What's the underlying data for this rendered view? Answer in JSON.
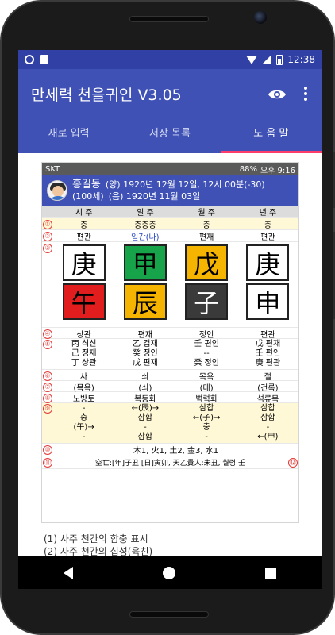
{
  "status_bar": {
    "time": "12:38"
  },
  "app_bar": {
    "title": "만세력 천을귀인 V3.05",
    "actions": [
      "eye-icon",
      "menu-icon"
    ]
  },
  "tabs": [
    {
      "label": "새로 입력"
    },
    {
      "label": "저장 목록"
    },
    {
      "label": "도 움 말",
      "active": true
    }
  ],
  "embedded": {
    "status_left": "SKT",
    "status_right": "88%",
    "status_time": "오후 9:16",
    "header": {
      "name": "홍길동",
      "age": "(100세)",
      "solar": "(양) 1920년 12월 12일, 12시 00분(-30)",
      "lunar": "(음) 1920년 11월 03일"
    },
    "columns": [
      "시 주",
      "일 주",
      "월 주",
      "년 주"
    ],
    "row1": {
      "n": "①",
      "cells": [
        "충",
        "충충충",
        "충",
        "충"
      ]
    },
    "row2": {
      "n": "②",
      "cells": [
        "편관",
        "일간(나)",
        "편재",
        "편관"
      ]
    },
    "row3": {
      "n": "③"
    },
    "stems": [
      {
        "ch": "庚",
        "bg": "#ffffff",
        "fg": "#000000"
      },
      {
        "ch": "甲",
        "bg": "#17a34a",
        "fg": "#000000"
      },
      {
        "ch": "戊",
        "bg": "#f5b400",
        "fg": "#000000"
      },
      {
        "ch": "庚",
        "bg": "#ffffff",
        "fg": "#000000"
      }
    ],
    "branches": [
      {
        "ch": "午",
        "bg": "#e11d1d",
        "fg": "#000000"
      },
      {
        "ch": "辰",
        "bg": "#f5b400",
        "fg": "#000000"
      },
      {
        "ch": "子",
        "bg": "#3a3a3a",
        "fg": "#ffffff"
      },
      {
        "ch": "申",
        "bg": "#ffffff",
        "fg": "#000000"
      }
    ],
    "row4": {
      "n": "④",
      "cells": [
        "상관",
        "편재",
        "정인",
        "편관"
      ]
    },
    "row5": {
      "n": "⑤",
      "lines": [
        [
          "丙 식신",
          "乙 겁재",
          "壬 편인",
          "戊 편재"
        ],
        [
          "己 정재",
          "癸 정인",
          "--",
          "壬 편인"
        ],
        [
          "丁 상관",
          "戊 편재",
          "癸 정인",
          "庚 편관"
        ]
      ]
    },
    "row6": {
      "n": "⑥",
      "cells": [
        "사",
        "쇠",
        "목욕",
        "절"
      ]
    },
    "row7": {
      "n": "⑦",
      "cells": [
        "(목욕)",
        "(쇠)",
        "(태)",
        "(건록)"
      ]
    },
    "row8": {
      "n": "⑧",
      "cells": [
        "노방토",
        "복등화",
        "벽력화",
        "석류목"
      ]
    },
    "row9": {
      "n": "⑨",
      "lines": [
        [
          "-",
          "←(辰)→",
          "삼합",
          "삼합"
        ],
        [
          "충",
          "삼합",
          "←(子)→",
          "삼합"
        ],
        [
          "(午)→",
          "-",
          "충",
          "-"
        ],
        [
          "-",
          "삼합",
          "-",
          "←(申)"
        ]
      ]
    },
    "row10": {
      "n": "⑩",
      "text": "木1, 火1, 土2, 金3, 水1"
    },
    "row11": {
      "n": "⑪",
      "text": "空亡:[年]子丑 [日]寅卯, 天乙貴人:未丑, 월령:壬",
      "n2": "⑫"
    }
  },
  "notes": [
    "(1) 사주 천간의 합충 표시",
    "(2) 사주 천간의 십성(육친)"
  ]
}
